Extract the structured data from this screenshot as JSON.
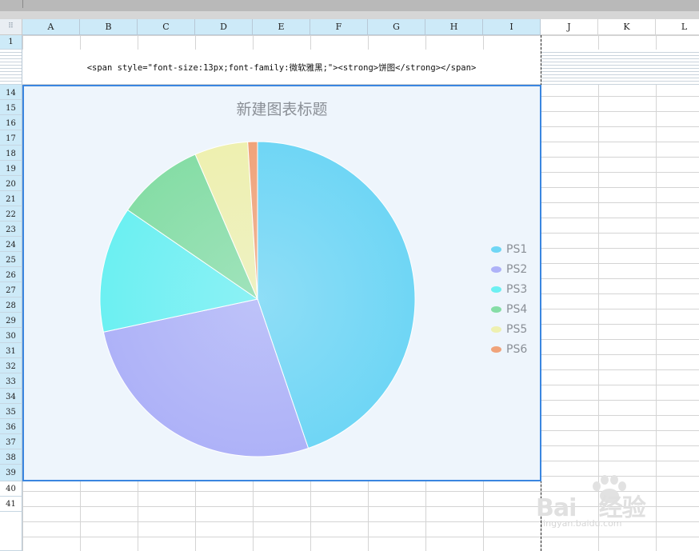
{
  "columns": [
    "A",
    "B",
    "C",
    "D",
    "E",
    "F",
    "G",
    "H",
    "I",
    "J",
    "K",
    "L"
  ],
  "rows": [
    "1",
    "14",
    "15",
    "16",
    "17",
    "18",
    "19",
    "20",
    "21",
    "22",
    "23",
    "24",
    "25",
    "26",
    "27",
    "28",
    "29",
    "30",
    "31",
    "32",
    "33",
    "34",
    "35",
    "36",
    "37",
    "38",
    "39",
    "40",
    "41"
  ],
  "merged_cell_text": "<span style=\"font-size:13px;font-family:微软雅黑;\"><strong>饼图</strong></span>",
  "chart_data": {
    "type": "pie",
    "title": "新建图表标题",
    "legend_position": "right",
    "categories": [
      "PS1",
      "PS2",
      "PS3",
      "PS4",
      "PS5",
      "PS6"
    ],
    "values": [
      45,
      27,
      13,
      9,
      5.5,
      1
    ],
    "colors": [
      "#6fd6f5",
      "#aeb2f8",
      "#6cf0f2",
      "#86dda6",
      "#eef0b0",
      "#f0a37a"
    ]
  },
  "watermark": {
    "brand": "Bai   经验",
    "url": "jingyan.baidu.com"
  }
}
